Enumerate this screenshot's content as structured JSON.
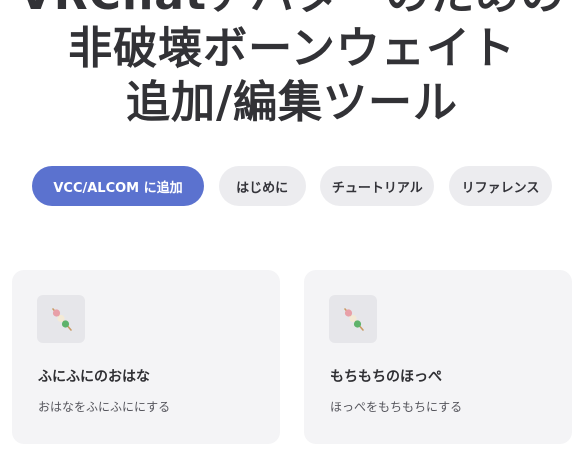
{
  "hero": {
    "line1": "VRChatアバターのための",
    "line2": "非破壊ボーンウェイト",
    "line3": "追加/編集ツール"
  },
  "actions": {
    "primary_label": "VCC/ALCOM に追加",
    "getting_started_label": "はじめに",
    "tutorial_label": "チュートリアル",
    "reference_label": "リファレンス"
  },
  "cards": [
    {
      "icon": "dango-skewer-icon",
      "title": "ふにふにのおはな",
      "description": "おはなをふにふににする"
    },
    {
      "icon": "dango-skewer-icon",
      "title": "もちもちのほっぺ",
      "description": "ほっぺをもちもちにする"
    }
  ],
  "colors": {
    "accent": "#5b72cf",
    "secondary_button": "#ececef",
    "card_bg": "#f4f4f6",
    "text": "#323236"
  }
}
